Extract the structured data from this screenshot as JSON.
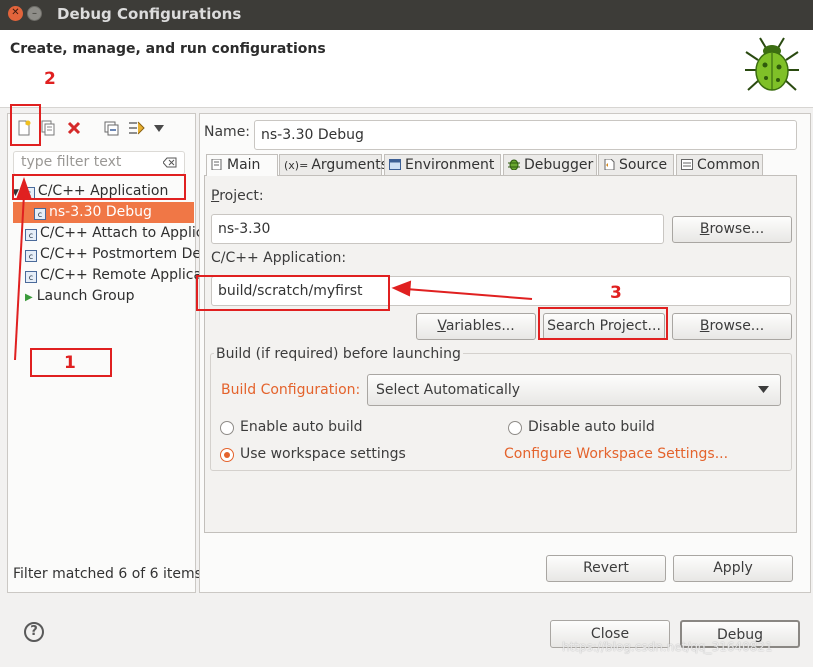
{
  "window": {
    "title": "Debug Configurations",
    "close_glyph": "✕",
    "min_glyph": "–"
  },
  "header": {
    "subtitle": "Create, manage, and run configurations"
  },
  "left": {
    "filter_placeholder": "type filter text",
    "tree": [
      {
        "label": "C/C++ Application"
      },
      {
        "label": "ns-3.30 Debug"
      },
      {
        "label": "C/C++ Attach to Applic"
      },
      {
        "label": "C/C++ Postmortem De"
      },
      {
        "label": "C/C++ Remote Applicat"
      },
      {
        "label": "Launch Group"
      }
    ],
    "status": "Filter matched 6 of 6 items"
  },
  "right": {
    "name_label": "Name:",
    "name_value": "ns-3.30 Debug",
    "tabs": [
      "Main",
      "Arguments",
      "Environment",
      "Debugger",
      "Source",
      "Common"
    ],
    "project_label": "Project:",
    "project_value": "ns-3.30",
    "app_label": "C/C++ Application:",
    "app_value": "build/scratch/myfirst",
    "browse1": "Browse...",
    "variables": "Variables...",
    "search_project": "Search Project...",
    "browse2": "Browse...",
    "build_group_label": "Build (if required) before launching",
    "build_config_label": "Build Configuration:",
    "build_config_value": "Select Automatically",
    "enable_auto_build": "Enable auto build",
    "disable_auto_build": "Disable auto build",
    "use_workspace": "Use workspace settings",
    "configure_link": "Configure Workspace Settings...",
    "revert": "Revert",
    "apply": "Apply"
  },
  "footer": {
    "help": "?",
    "close": "Close",
    "debug": "Debug",
    "watermark": "https://blog.csdn.net/qq_31640821"
  },
  "annotations": {
    "n1": "1",
    "n2": "2",
    "n3": "3",
    "color": "#e02020"
  },
  "colors": {
    "accent_orange": "#e4632c",
    "selection": "#f07746",
    "titlebar": "#3d3c38"
  }
}
